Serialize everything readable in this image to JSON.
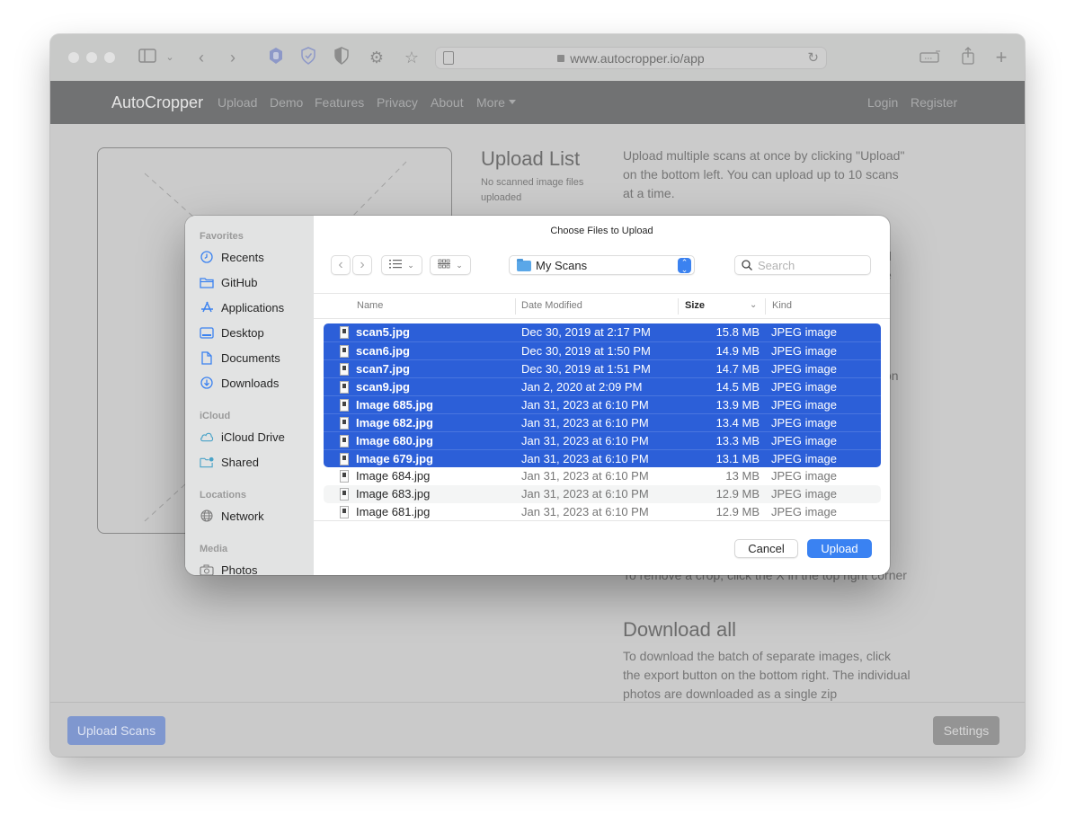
{
  "browser": {
    "url": "www.autocropper.io/app",
    "toolbar_icons": [
      "sidebar-icon",
      "chevron-down-icon",
      "back-icon",
      "forward-icon",
      "hand-stop-icon",
      "shield-check-icon",
      "half-shield-icon",
      "gear-icon",
      "star-icon",
      "reader-icon",
      "lock-icon",
      "reload-icon",
      "tab-overview-icon",
      "share-icon",
      "new-tab-icon"
    ]
  },
  "site": {
    "brand": "AutoCropper",
    "nav": [
      "Upload",
      "Demo",
      "Features",
      "Privacy",
      "About",
      "More"
    ],
    "auth": [
      "Login",
      "Register"
    ]
  },
  "page": {
    "upload_list_title": "Upload List",
    "upload_list_empty": "No scanned image files uploaded",
    "help_intro": "Upload multiple scans at once by clicking \"Upload\" on the bottom left. You can upload up to 10 scans at a time.",
    "help_partial_1": "d",
    "help_partial_2": "e",
    "help_partial_3": "on",
    "remove_crop_text": "To remove a crop, click the X in the top right corner",
    "download_heading": "Download all",
    "download_text": "To download the batch of separate images, click the export button on the bottom right. The individual photos are downloaded as a single zip",
    "upload_scans_button": "Upload Scans",
    "settings_button": "Settings"
  },
  "dialog": {
    "title": "Choose Files to Upload",
    "location": "My Scans",
    "search_placeholder": "Search",
    "sidebar": {
      "sections": [
        {
          "label": "Favorites",
          "items": [
            {
              "label": "Recents",
              "icon": "clock-icon"
            },
            {
              "label": "GitHub",
              "icon": "folder-icon"
            },
            {
              "label": "Applications",
              "icon": "applications-icon"
            },
            {
              "label": "Desktop",
              "icon": "desktop-icon"
            },
            {
              "label": "Documents",
              "icon": "document-icon"
            },
            {
              "label": "Downloads",
              "icon": "download-icon"
            }
          ]
        },
        {
          "label": "iCloud",
          "items": [
            {
              "label": "iCloud Drive",
              "icon": "cloud-icon"
            },
            {
              "label": "Shared",
              "icon": "shared-folder-icon"
            }
          ]
        },
        {
          "label": "Locations",
          "items": [
            {
              "label": "Network",
              "icon": "globe-icon"
            }
          ]
        },
        {
          "label": "Media",
          "items": [
            {
              "label": "Photos",
              "icon": "camera-icon"
            }
          ]
        }
      ]
    },
    "columns": {
      "name": "Name",
      "date": "Date Modified",
      "size": "Size",
      "kind": "Kind"
    },
    "sort_column": "Size",
    "files": [
      {
        "name": "scan5.jpg",
        "date": "Dec 30, 2019 at 2:17 PM",
        "size": "15.8 MB",
        "kind": "JPEG image",
        "selected": true
      },
      {
        "name": "scan6.jpg",
        "date": "Dec 30, 2019 at 1:50 PM",
        "size": "14.9 MB",
        "kind": "JPEG image",
        "selected": true
      },
      {
        "name": "scan7.jpg",
        "date": "Dec 30, 2019 at 1:51 PM",
        "size": "14.7 MB",
        "kind": "JPEG image",
        "selected": true
      },
      {
        "name": "scan9.jpg",
        "date": "Jan 2, 2020 at 2:09 PM",
        "size": "14.5 MB",
        "kind": "JPEG image",
        "selected": true
      },
      {
        "name": "Image 685.jpg",
        "date": "Jan 31, 2023 at 6:10 PM",
        "size": "13.9 MB",
        "kind": "JPEG image",
        "selected": true
      },
      {
        "name": "Image 682.jpg",
        "date": "Jan 31, 2023 at 6:10 PM",
        "size": "13.4 MB",
        "kind": "JPEG image",
        "selected": true
      },
      {
        "name": "Image 680.jpg",
        "date": "Jan 31, 2023 at 6:10 PM",
        "size": "13.3 MB",
        "kind": "JPEG image",
        "selected": true
      },
      {
        "name": "Image 679.jpg",
        "date": "Jan 31, 2023 at 6:10 PM",
        "size": "13.1 MB",
        "kind": "JPEG image",
        "selected": true
      },
      {
        "name": "Image 684.jpg",
        "date": "Jan 31, 2023 at 6:10 PM",
        "size": "13 MB",
        "kind": "JPEG image",
        "selected": false
      },
      {
        "name": "Image 683.jpg",
        "date": "Jan 31, 2023 at 6:10 PM",
        "size": "12.9 MB",
        "kind": "JPEG image",
        "selected": false
      },
      {
        "name": "Image 681.jpg",
        "date": "Jan 31, 2023 at 6:10 PM",
        "size": "12.9 MB",
        "kind": "JPEG image",
        "selected": false
      }
    ],
    "cancel_button": "Cancel",
    "upload_button": "Upload"
  },
  "colors": {
    "selection": "#2c5fd8",
    "primary_button": "#3a82f2",
    "sidebar_icon": "#3b82f0"
  }
}
